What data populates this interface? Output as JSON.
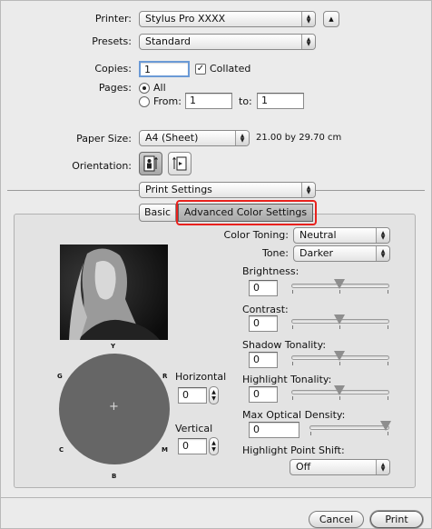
{
  "printer": {
    "label": "Printer:",
    "value": "Stylus Pro XXXX"
  },
  "presets": {
    "label": "Presets:",
    "value": "Standard"
  },
  "copies": {
    "label": "Copies:",
    "value": "1",
    "collated_label": "Collated",
    "collated_checked": true
  },
  "pages": {
    "label": "Pages:",
    "all_label": "All",
    "from_label": "From:",
    "from_value": "1",
    "to_label": "to:",
    "to_value": "1"
  },
  "paper_size": {
    "label": "Paper Size:",
    "value": "A4 (Sheet)",
    "dimensions": "21.00 by 29.70 cm"
  },
  "orientation": {
    "label": "Orientation:"
  },
  "panel_select": {
    "value": "Print Settings"
  },
  "tabs": [
    {
      "label": "Basic",
      "selected": false
    },
    {
      "label": "Advanced Color Settings",
      "selected": true
    }
  ],
  "color_toning": {
    "label": "Color Toning:",
    "value": "Neutral"
  },
  "tone": {
    "label": "Tone:",
    "value": "Darker"
  },
  "brightness": {
    "label": "Brightness:",
    "value": "0"
  },
  "contrast": {
    "label": "Contrast:",
    "value": "0"
  },
  "shadow_tonality": {
    "label": "Shadow Tonality:",
    "value": "0"
  },
  "highlight_tonality": {
    "label": "Highlight Tonality:",
    "value": "0"
  },
  "max_optical_density": {
    "label": "Max Optical Density:",
    "value": "0"
  },
  "highlight_point_shift": {
    "label": "Highlight Point Shift:",
    "value": "Off"
  },
  "color_wheel": {
    "top": "Y",
    "left": "G",
    "right": "R",
    "bottom_left": "C",
    "bottom_right": "M",
    "bottom": "B"
  },
  "horizontal": {
    "label": "Horizontal",
    "value": "0"
  },
  "vertical": {
    "label": "Vertical",
    "value": "0"
  },
  "buttons": {
    "cancel": "Cancel",
    "print": "Print"
  },
  "colors": {
    "highlight": "#e8211d",
    "wheel": "#666666"
  }
}
